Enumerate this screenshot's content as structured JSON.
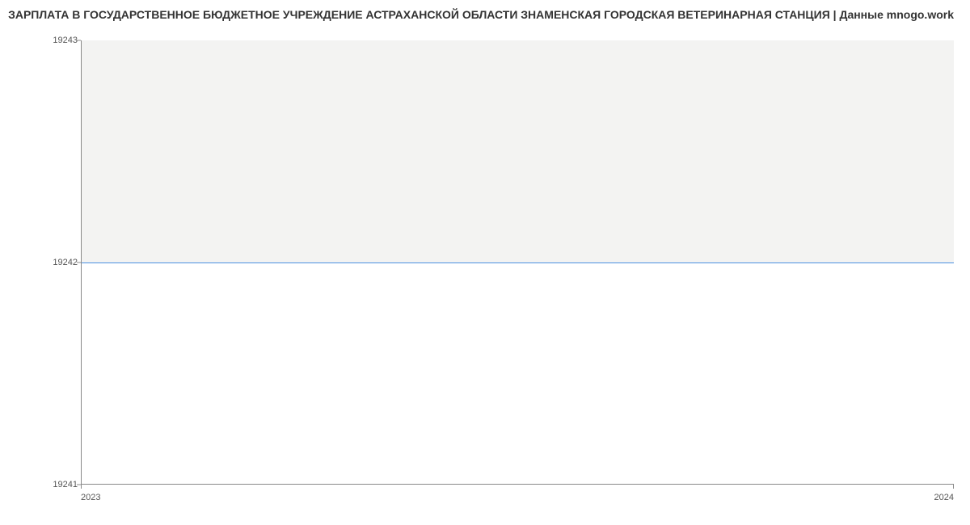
{
  "chart_data": {
    "type": "line",
    "title": "ЗАРПЛАТА В ГОСУДАРСТВЕННОЕ БЮДЖЕТНОЕ УЧРЕЖДЕНИЕ АСТРАХАНСКОЙ ОБЛАСТИ ЗНАМЕНСКАЯ ГОРОДСКАЯ ВЕТЕРИНАРНАЯ СТАНЦИЯ | Данные mnogo.work",
    "x": [
      "2023",
      "2024"
    ],
    "values": [
      19242,
      19242
    ],
    "ylim": [
      19241,
      19243
    ],
    "y_ticks": [
      "19241",
      "19242",
      "19243"
    ],
    "x_ticks": [
      "2023",
      "2024"
    ],
    "xlabel": "",
    "ylabel": ""
  }
}
